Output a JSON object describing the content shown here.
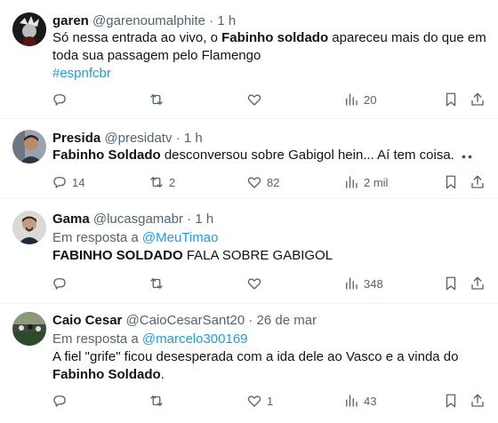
{
  "tweets": [
    {
      "name": "garen",
      "handle": "@garenoumalphite",
      "sep": "·",
      "time": "1 h",
      "line1": {
        "pre": "Só nessa entrada ao vivo, o ",
        "bold": "Fabinho soldado",
        "post": " apareceu mais do que em"
      },
      "line2": "toda sua passagem pelo Flamengo",
      "hashtag": "#espnfcbr",
      "reply_count": "",
      "retweet_count": "",
      "like_count": "",
      "view_count": "20"
    },
    {
      "name": "Presida",
      "handle": "@presidatv",
      "sep": "·",
      "time": "1 h",
      "line1": {
        "bold": "Fabinho Soldado",
        "post": " desconversou sobre Gabigol hein... Aí tem coisa."
      },
      "emoji": "eyes",
      "reply_count": "14",
      "retweet_count": "2",
      "like_count": "82",
      "view_count": "2 mil"
    },
    {
      "name": "Gama",
      "handle": "@lucasgamabr",
      "sep": "·",
      "time": "1 h",
      "reply_prefix": "Em resposta a ",
      "reply_to": "@MeuTimao",
      "line1": {
        "bold": "FABINHO SOLDADO",
        "post": " FALA SOBRE GABIGOL"
      },
      "reply_count": "",
      "retweet_count": "",
      "like_count": "",
      "view_count": "348"
    },
    {
      "name": "Caio Cesar",
      "handle": "@CaioCesarSant20",
      "sep": "·",
      "time": "26 de mar",
      "reply_prefix": "Em resposta a ",
      "reply_to": "@marcelo300169",
      "line1": {
        "pre": "A fiel \"grife\" ficou desesperada com a ida dele ao Vasco e a vinda do"
      },
      "line2": {
        "bold": "Fabinho Soldado",
        "post": "."
      },
      "reply_count": "",
      "retweet_count": "",
      "like_count": "1",
      "view_count": "43"
    }
  ],
  "colors": {
    "link": "#1d9bf0",
    "muted": "#536471",
    "text": "#0f1419",
    "divider": "#eff3f4"
  },
  "icons": [
    "reply-icon",
    "retweet-icon",
    "like-icon",
    "views-icon",
    "bookmark-icon",
    "share-icon"
  ]
}
